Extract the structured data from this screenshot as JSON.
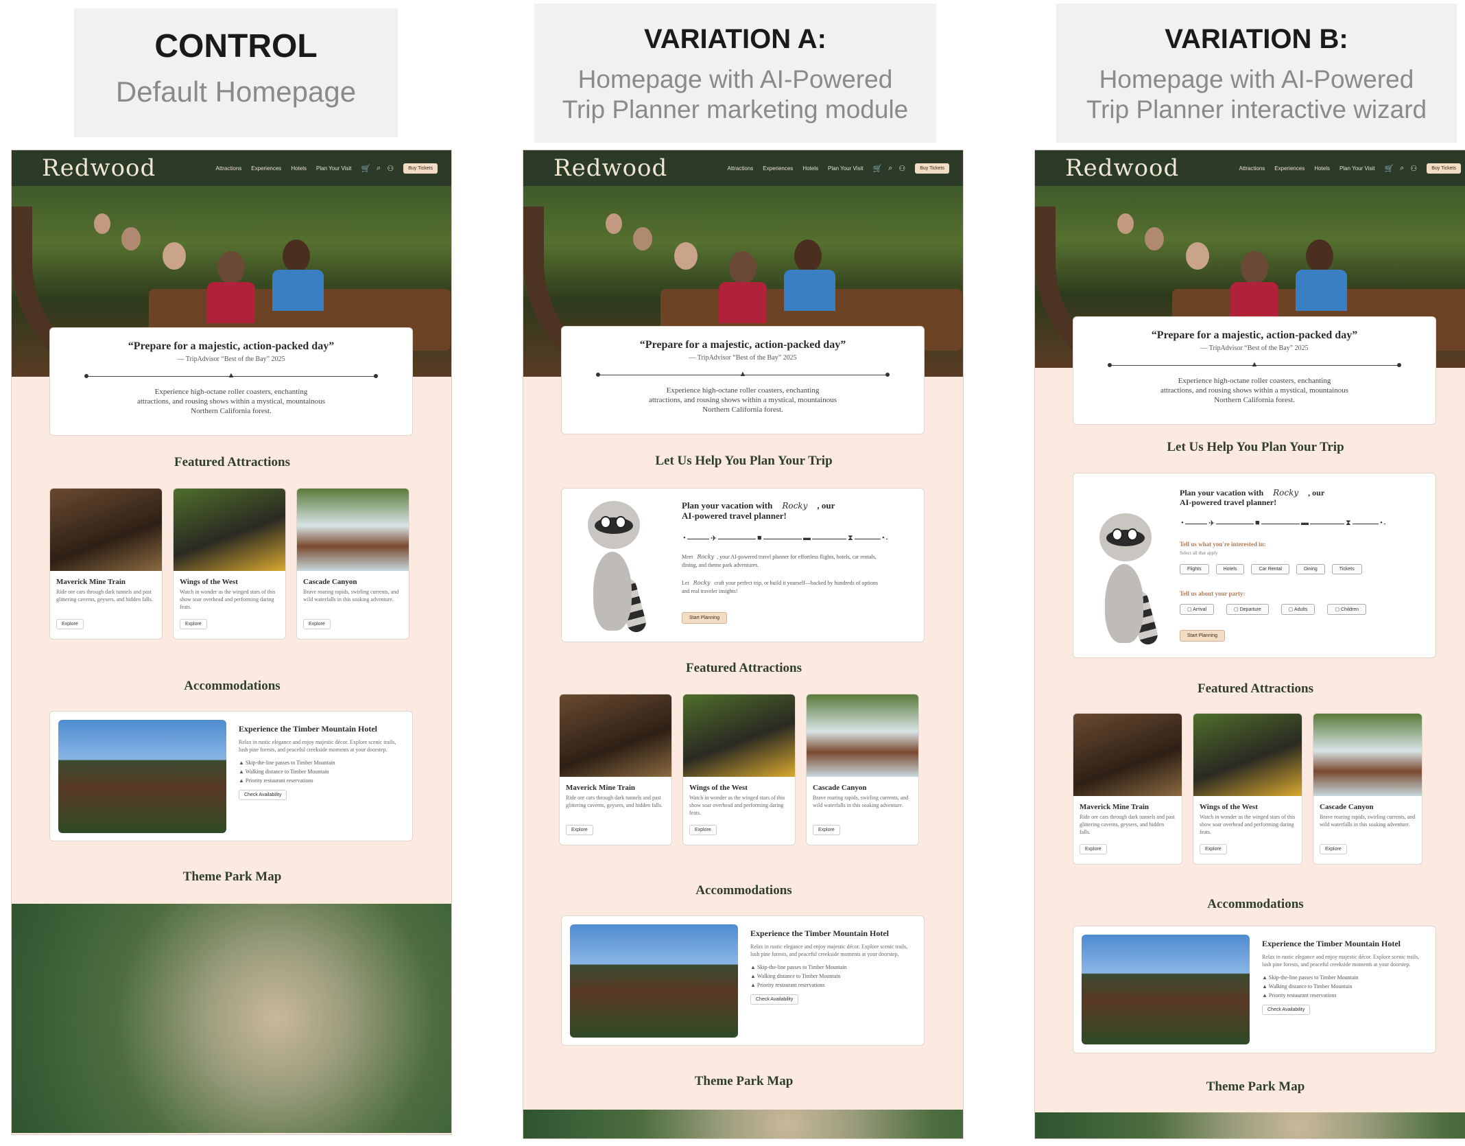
{
  "labels": {
    "control": {
      "title": "CONTROL",
      "subtitle": "Default Homepage"
    },
    "variation_a": {
      "title": "VARIATION A:",
      "subtitle_1": "Homepage with AI-Powered",
      "subtitle_2": "Trip Planner marketing module"
    },
    "variation_b": {
      "title": "VARIATION B:",
      "subtitle_1": "Homepage with AI-Powered",
      "subtitle_2": "Trip Planner interactive wizard"
    }
  },
  "site": {
    "logo": "Redwood",
    "nav": [
      "Attractions",
      "Experiences",
      "Hotels",
      "Plan Your Visit"
    ],
    "buy_label": "Buy Tickets",
    "icons": [
      "cart-icon",
      "search-icon",
      "user-icon"
    ]
  },
  "hero": {
    "quote": "“Prepare for a majestic, action-packed day”",
    "source": "— TripAdvisor “Best of the Bay” 2025",
    "body_1": "Experience high-octane roller coasters, enchanting",
    "body_2": "attractions, and rousing shows within a mystical, mountainous",
    "body_3": "Northern California forest."
  },
  "sections": {
    "attractions": "Featured Attractions",
    "accommodations": "Accommodations",
    "map": "Theme Park Map",
    "planner": "Let Us Help You Plan Your Trip"
  },
  "attractions": [
    {
      "title": "Maverick Mine Train",
      "body": "Ride ore cars through dark tunnels and past glittering caverns, geysers, and hidden falls.",
      "button": "Explore"
    },
    {
      "title": "Wings of the West",
      "body": "Watch in wonder as the winged stars of this show soar overhead and performing daring feats.",
      "button": "Explore"
    },
    {
      "title": "Cascade Canyon",
      "body": "Brave roaring rapids, swirling currents, and wild waterfalls in this soaking adventure.",
      "button": "Explore"
    }
  ],
  "hotel": {
    "title": "Experience the Timber Mountain Hotel",
    "body": "Relax in rustic elegance and enjoy majestic décor. Explore scenic trails, lush pine forests, and peaceful creekside moments at your doorstep.",
    "bullets": [
      "Skip-the-line passes to Timber Mountain",
      "Walking distance to Timber Mountain",
      "Priority restaurant reservations"
    ],
    "button": "Check Availability"
  },
  "planner": {
    "title_1": "Plan your vacation with",
    "rocky": "Rocky",
    "title_1b": ", our",
    "title_2": "AI-powered travel planner!",
    "meet": "Meet",
    "meet_rest": ", your AI-powered travel planner for effortless flights, hotels, car rentals, dining, and theme park adventures.",
    "let": "Let",
    "let_rest": "craft your perfect trip, or build it yourself—backed by hundreds of options and real traveler insights!",
    "button": "Start Planning"
  },
  "wizard": {
    "interest_label": "Tell us what you're interested in:",
    "interest_sub": "Select all that apply",
    "interests": [
      "Flights",
      "Hotels",
      "Car Rental",
      "Dining",
      "Tickets"
    ],
    "party_label": "Tell us about your party:",
    "party": [
      "Arrival",
      "Departure",
      "Adults",
      "Children"
    ],
    "button": "Start Planning"
  },
  "colors": {
    "nav": "#2c3a28",
    "page_bg": "#fce9df",
    "section_title": "#2f3f2a",
    "accent": "#b07a5a"
  }
}
